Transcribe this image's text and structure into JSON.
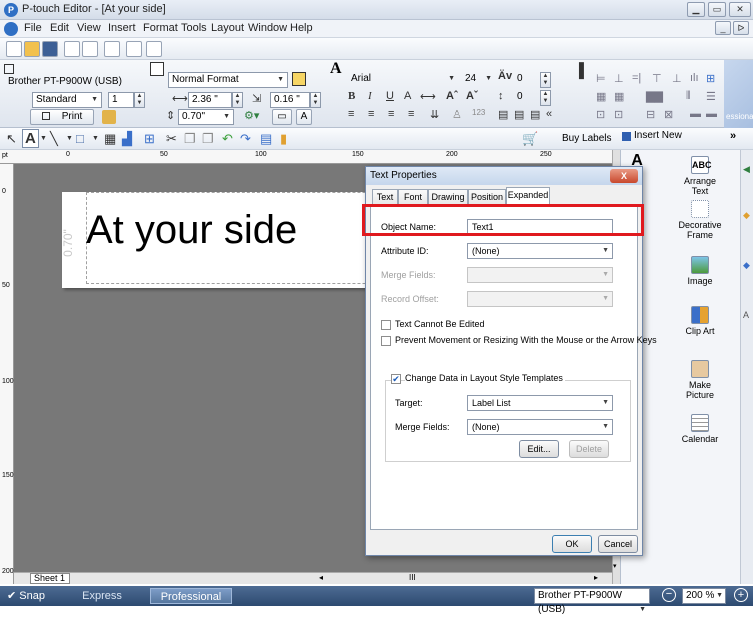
{
  "window": {
    "title": "P-touch Editor - [At your side]",
    "app_icon": "P"
  },
  "menu": [
    "File",
    "Edit",
    "View",
    "Insert",
    "Format",
    "Tools",
    "Layout",
    "Window",
    "Help"
  ],
  "ribbon": {
    "printer": "Brother PT-P900W (USB)",
    "quality": "Standard",
    "copies": "1",
    "print_label": "Print",
    "format": "Normal Format",
    "width": "2.36 \"",
    "length": "0.16 \"",
    "tape": "0.70\"",
    "font": "Arial",
    "font_size": "24",
    "spacing": "0",
    "line_spacing": "0"
  },
  "toolbar2": {
    "buy_labels": "Buy Labels",
    "insert_new": "Insert New",
    "more": "»"
  },
  "ruler": {
    "unit": "pt",
    "marks": [
      "0",
      "50",
      "100",
      "150",
      "200",
      "250"
    ]
  },
  "vruler": {
    "marks": [
      "0",
      "50",
      "100",
      "150",
      "200"
    ]
  },
  "canvas": {
    "label_text": "At your side",
    "tape_width_label": "0.70\""
  },
  "sheet": {
    "tab": "Sheet 1",
    "scroll_mid": "III"
  },
  "side_panel": {
    "items": [
      {
        "label": "Arrange Text",
        "icon": "ABC"
      },
      {
        "label": "Decorative Frame",
        "icon": ""
      },
      {
        "label": "Image",
        "icon": ""
      },
      {
        "label": "Clip Art",
        "icon": ""
      },
      {
        "label": "Make Picture",
        "icon": ""
      },
      {
        "label": "Calendar",
        "icon": ""
      }
    ],
    "cut_text": "essional"
  },
  "statusbar": {
    "snap": "Snap",
    "modes": [
      "Express",
      "Professional"
    ],
    "printer": "Brother PT-P900W (USB)",
    "zoom": "200 %"
  },
  "dialog": {
    "title": "Text Properties",
    "close": "X",
    "tabs": [
      "Text",
      "Font",
      "Drawing",
      "Position",
      "Expanded"
    ],
    "active_tab": "Expanded",
    "object_name_label": "Object Name:",
    "object_name_value": "Text1",
    "attribute_id_label": "Attribute ID:",
    "attribute_id_value": "(None)",
    "merge_fields_label": "Merge Fields:",
    "record_offset_label": "Record Offset:",
    "cb_no_edit": "Text Cannot Be Edited",
    "cb_prevent_move": "Prevent Movement or Resizing With the Mouse or the Arrow Keys",
    "cb_change_data": "Change Data in Layout Style Templates",
    "target_label": "Target:",
    "target_value": "Label List",
    "merge_fields2_label": "Merge Fields:",
    "merge_fields2_value": "(None)",
    "edit_btn": "Edit...",
    "delete_btn": "Delete",
    "ok_btn": "OK",
    "cancel_btn": "Cancel"
  },
  "colors": {
    "highlight": "#e0191e",
    "statusbar": "#2d4a70"
  }
}
